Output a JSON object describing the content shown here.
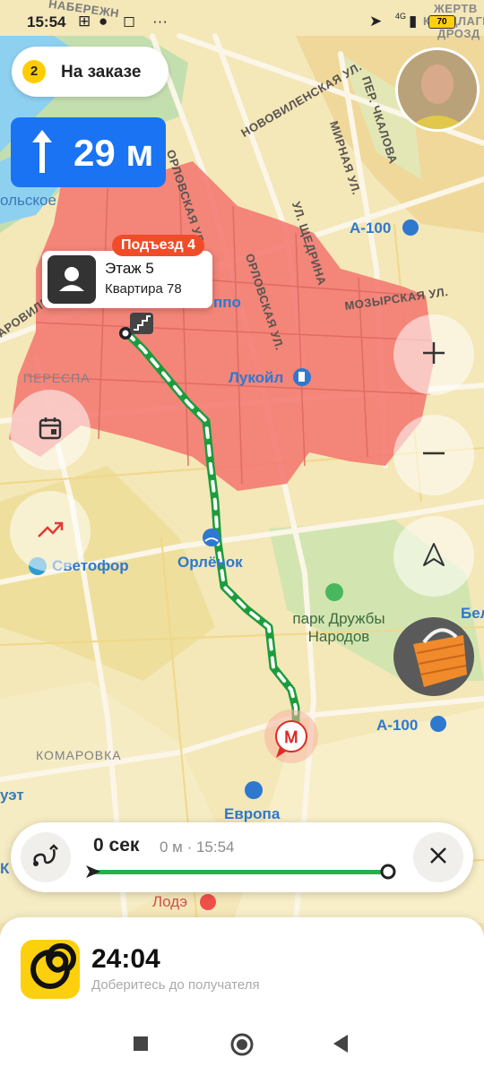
{
  "status_bar": {
    "time": "15:54",
    "battery": "70",
    "network": "4G"
  },
  "order_pill": {
    "count": "2",
    "label": "На заказе"
  },
  "maneuver": {
    "direction": "arrow-up-icon",
    "distance": "29 м"
  },
  "destination_popup": {
    "entrance": "Подъезд 4",
    "floor": "Этаж 5",
    "apartment": "Квартира 78"
  },
  "map_labels": {
    "streets": {
      "orlovskaya_1": "ОРЛОВСКАЯ УЛ.",
      "orlovskaya_2": "ОРЛОВСКАЯ УЛ.",
      "novovilenskaya": "НОВОВИЛЕНСКАЯ УЛ.",
      "mirnaya": "МИРНАЯ УЛ.",
      "shchedrina": "УЛ. ЩЕДРИНА",
      "mozyrskaya": "МОЗЫРСКАЯ УЛ.",
      "chkalova": "ПЕР. ЧКАЛОВА",
      "perovilen": "АРОВИЛЕН",
      "zhertvy": "ЖЕРТВ",
      "konnogo": "КОНЦЛАГЕРЕ",
      "drozdy": "ДРОЗД"
    },
    "districts": {
      "perespa": "ПЕРЕСПА",
      "komarovka": "КОМАРОВКА"
    },
    "road_a100_top": "А-100",
    "road_a100_bottom": "А-100",
    "pois": {
      "lukoil": "Лукойл",
      "svetofor": "Светофор",
      "orlenok": "Орлёнок",
      "park": "парк Дружбы Народов",
      "evropa": "Европа",
      "lode": "Лодэ",
      "naberezhn": "НАБЕРЕЖН",
      "polskoe": "ольское",
      "ippo": "ппо",
      "bel": "Бело",
      "uet": "уэт",
      "k": "К"
    }
  },
  "route_card": {
    "eta": "0 сек",
    "meta": "0 м · 15:54",
    "progress": 0.98
  },
  "bottom_sheet": {
    "time": "24:04",
    "hint": "Доберитесь до получателя"
  },
  "colors": {
    "accent_blue": "#1a73f2",
    "route_green": "#22b24c",
    "zone_red": "#f47a72",
    "entrance_red": "#f14c29",
    "brand_yellow": "#fcd00d"
  },
  "icons": {
    "compass": "navigation-arrow-icon",
    "zoom_in": "plus-icon",
    "zoom_out": "minus-icon",
    "calendar": "calendar-icon",
    "traffic": "trend-icon",
    "basket": "basket-icon",
    "route": "route-icon",
    "close": "close-icon"
  }
}
